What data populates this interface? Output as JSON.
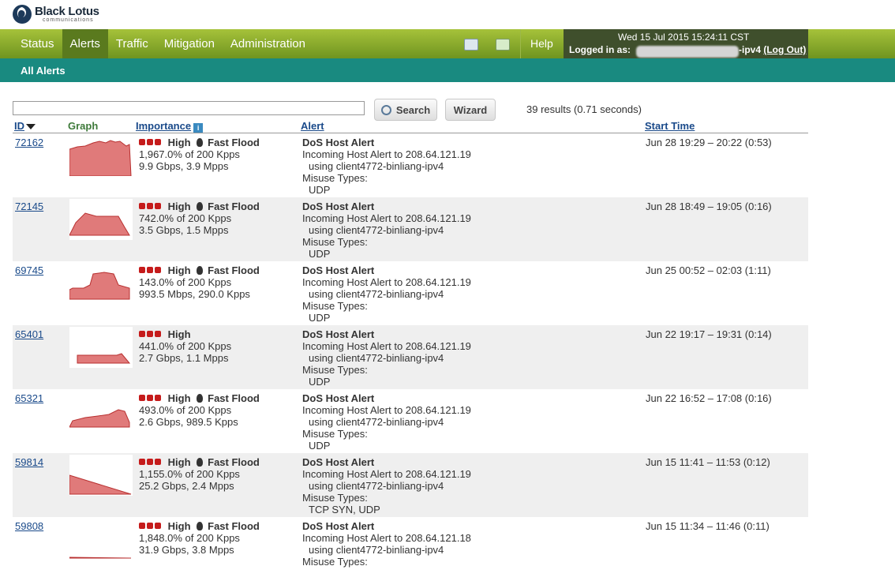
{
  "logo": {
    "name": "Black Lotus",
    "sub": "communications"
  },
  "nav": {
    "items": [
      {
        "label": "Status",
        "active": false
      },
      {
        "label": "Alerts",
        "active": true
      },
      {
        "label": "Traffic",
        "active": false
      },
      {
        "label": "Mitigation",
        "active": false
      },
      {
        "label": "Administration",
        "active": false
      }
    ]
  },
  "tools": {
    "icons": [
      "window-icon",
      "mail-icon"
    ],
    "help": "Help"
  },
  "user": {
    "date": "Wed 15 Jul 2015 15:24:11 CST",
    "logged_in_label": "Logged in as:",
    "suffix": "-ipv4",
    "logout": "(Log Out)"
  },
  "subnav": {
    "title": "All Alerts"
  },
  "search": {
    "value": "",
    "button": "Search",
    "wizard": "Wizard",
    "results": "39 results (0.71 seconds)"
  },
  "columns": {
    "id": "ID",
    "graph": "Graph",
    "importance": "Importance",
    "alert": "Alert",
    "start_time": "Start Time"
  },
  "colors": {
    "nav_green": "#7a9a24",
    "teal": "#198a80",
    "alert_red": "#c51b1b",
    "graph_fill": "#e07a7a"
  },
  "alerts": [
    {
      "id": "72162",
      "level": "High",
      "type": "Fast Flood",
      "pct": "1,967.0% of 200 Kpps",
      "rate": "9.9 Gbps, 3.9 Mpps",
      "title": "DoS Host Alert",
      "line1": "Incoming Host Alert to 208.64.121.19",
      "line2": "using client4772-binliang-ipv4",
      "misuse_label": "Misuse Types:",
      "misuse": "UDP",
      "time": "Jun 28 19:29 – 20:22 (0:53)"
    },
    {
      "id": "72145",
      "level": "High",
      "type": "Fast Flood",
      "pct": "742.0% of 200 Kpps",
      "rate": "3.5 Gbps, 1.5 Mpps",
      "title": "DoS Host Alert",
      "line1": "Incoming Host Alert to 208.64.121.19",
      "line2": "using client4772-binliang-ipv4",
      "misuse_label": "Misuse Types:",
      "misuse": "UDP",
      "time": "Jun 28 18:49 – 19:05 (0:16)"
    },
    {
      "id": "69745",
      "level": "High",
      "type": "Fast Flood",
      "pct": "143.0% of 200 Kpps",
      "rate": "993.5 Mbps, 290.0 Kpps",
      "title": "DoS Host Alert",
      "line1": "Incoming Host Alert to 208.64.121.19",
      "line2": "using client4772-binliang-ipv4",
      "misuse_label": "Misuse Types:",
      "misuse": "UDP",
      "time": "Jun 25 00:52 – 02:03 (1:11)"
    },
    {
      "id": "65401",
      "level": "High",
      "type": "",
      "pct": "441.0% of 200 Kpps",
      "rate": "2.7 Gbps, 1.1 Mpps",
      "title": "DoS Host Alert",
      "line1": "Incoming Host Alert to 208.64.121.19",
      "line2": "using client4772-binliang-ipv4",
      "misuse_label": "Misuse Types:",
      "misuse": "UDP",
      "time": "Jun 22 19:17 – 19:31 (0:14)"
    },
    {
      "id": "65321",
      "level": "High",
      "type": "Fast Flood",
      "pct": "493.0% of 200 Kpps",
      "rate": "2.6 Gbps, 989.5 Kpps",
      "title": "DoS Host Alert",
      "line1": "Incoming Host Alert to 208.64.121.19",
      "line2": "using client4772-binliang-ipv4",
      "misuse_label": "Misuse Types:",
      "misuse": "UDP",
      "time": "Jun 22 16:52 – 17:08 (0:16)"
    },
    {
      "id": "59814",
      "level": "High",
      "type": "Fast Flood",
      "pct": "1,155.0% of 200 Kpps",
      "rate": "25.2 Gbps, 2.4 Mpps",
      "title": "DoS Host Alert",
      "line1": "Incoming Host Alert to 208.64.121.19",
      "line2": "using client4772-binliang-ipv4",
      "misuse_label": "Misuse Types:",
      "misuse": "TCP SYN, UDP",
      "time": "Jun 15 11:41 – 11:53 (0:12)"
    },
    {
      "id": "59808",
      "level": "High",
      "type": "Fast Flood",
      "pct": "1,848.0% of 200 Kpps",
      "rate": "31.9 Gbps, 3.8 Mpps",
      "title": "DoS Host Alert",
      "line1": "Incoming Host Alert to 208.64.121.18",
      "line2": "using client4772-binliang-ipv4",
      "misuse_label": "Misuse Types:",
      "misuse": "",
      "time": "Jun 15 11:34 – 11:46 (0:11)"
    }
  ]
}
